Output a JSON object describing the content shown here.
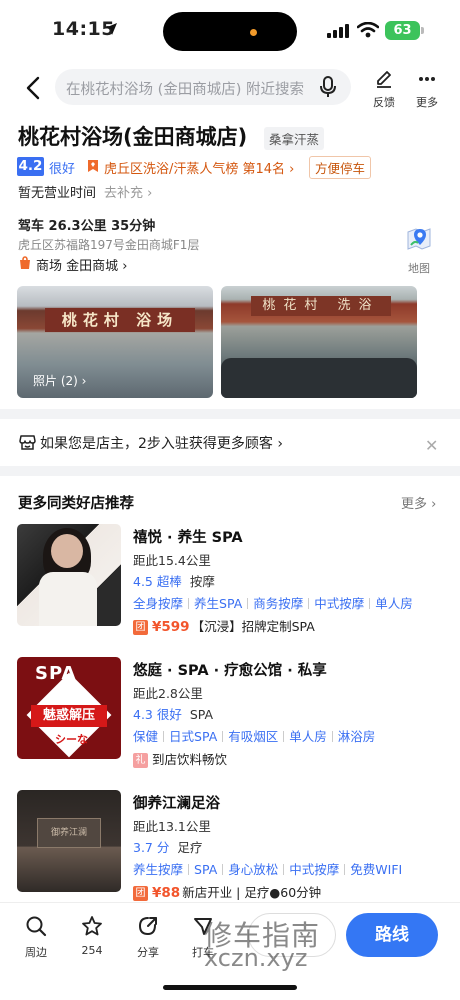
{
  "status": {
    "time": "14:15",
    "battery": "63"
  },
  "header": {
    "search_placeholder": "在桃花村浴场 (金田商城店) 附近搜索",
    "feedback_label": "反馈",
    "more_label": "更多"
  },
  "poi": {
    "name": "桃花村浴场(金田商城店)",
    "category": "桑拿汗蒸",
    "rating": "4.2",
    "rating_word": "很好",
    "rank_text": "虎丘区洗浴/汗蒸人气榜 第14名 ›",
    "parking": "方便停车",
    "hours": "暂无营业时间",
    "hours_link": "去补充 ›",
    "drive": "驾车 26.3公里 35分钟",
    "address": "虎丘区苏福路197号金田商城F1层",
    "mall": "商场 金田商城 ›",
    "map_label": "地图",
    "photo_count": "照片 (2) ›",
    "photo_sign_1": "桃花村 浴场",
    "photo_sign_2": "桃花村 洗浴"
  },
  "owner_banner": {
    "text": "如果您是店主，2步入驻获得更多顾客 ›"
  },
  "recommend": {
    "title": "更多同类好店推荐",
    "more": "更多 ›",
    "items": [
      {
        "name": "禧悦 · 养生 SPA",
        "distance": "距此15.4公里",
        "score": "4.5",
        "score_word": "超棒",
        "category": "按摩",
        "tags": [
          "全身按摩",
          "养生SPA",
          "商务按摩",
          "中式按摩",
          "单人房"
        ],
        "deal_badge": "团",
        "deal_price": "¥599",
        "deal_text": "【沉浸】招牌定制SPA"
      },
      {
        "name": "悠庭 · SPA · 疗愈公馆 · 私享",
        "distance": "距此2.8公里",
        "score": "4.3",
        "score_word": "很好",
        "category": "SPA",
        "tags": [
          "保健",
          "日式SPA",
          "有吸烟区",
          "单人房",
          "淋浴房"
        ],
        "deal_badge": "礼",
        "deal_price": "",
        "deal_text": "到店饮料畅饮",
        "thumb_top": "SPA",
        "thumb_mid": "魅惑解压",
        "thumb_bottom": "シーな"
      },
      {
        "name": "御养江澜足浴",
        "distance": "距此13.1公里",
        "score": "3.7",
        "score_word": "分",
        "category": "足疗",
        "tags": [
          "养生按摩",
          "SPA",
          "身心放松",
          "中式按摩",
          "免费WIFI"
        ],
        "deal_badge": "团",
        "deal_price": "¥88",
        "deal_text": "新店开业 | 足疗●60分钟",
        "thumb_wall": "御养江澜"
      }
    ]
  },
  "bottom_bar": {
    "nearby": "周边",
    "favorites": "254",
    "share": "分享",
    "call": "打车",
    "route": "路线"
  },
  "watermark": {
    "line1": "修车指南",
    "line2": "xczn.xyz"
  },
  "colors": {
    "accent_blue": "#3a6ff2",
    "route_blue": "#3477f4",
    "price_orange": "#f2552c",
    "rank_orange": "#d4570f"
  }
}
